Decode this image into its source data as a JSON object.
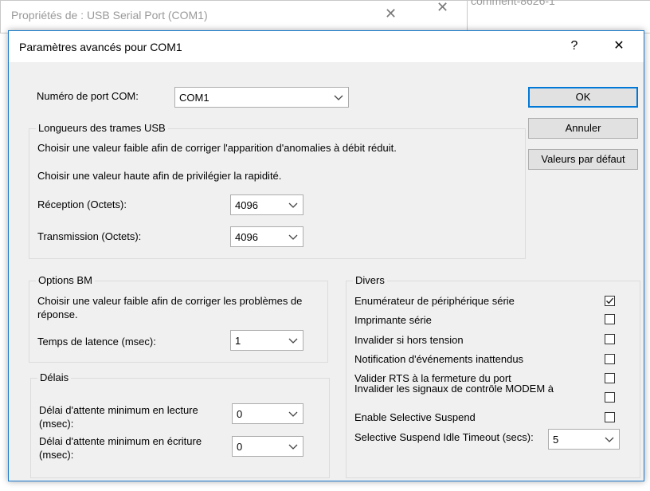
{
  "background": {
    "window_title": "Propriétés de : USB Serial Port (COM1)",
    "other_window_title": "comment-8626-1"
  },
  "dialog": {
    "title": "Paramètres avancés pour COM1",
    "help_label": "?",
    "close_label": "✕"
  },
  "com_port": {
    "label": "Numéro de port COM:",
    "value": "COM1"
  },
  "usb_frames": {
    "title": "Longueurs des trames USB",
    "desc_low": "Choisir une valeur faible afin de corriger  l'apparition d'anomalies à débit réduit.",
    "desc_high": "Choisir une valeur haute afin de privilégier la rapidité.",
    "reception_label": "Réception (Octets):",
    "reception_value": "4096",
    "transmission_label": "Transmission (Octets):",
    "transmission_value": "4096"
  },
  "bm_options": {
    "title": "Options BM",
    "desc": "Choisir une valeur faible afin de corriger les problèmes de réponse.",
    "latency_label": "Temps de latence (msec):",
    "latency_value": "1"
  },
  "timeouts": {
    "title": "Délais",
    "read_label": "Délai d'attente minimum en lecture (msec):",
    "read_value": "0",
    "write_label": "Délai d'attente minimum en écriture (msec):",
    "write_value": "0"
  },
  "misc": {
    "title": "Divers",
    "items": [
      {
        "label": "Enumérateur de périphérique série",
        "checked": true
      },
      {
        "label": "Imprimante série",
        "checked": false
      },
      {
        "label": "Invalider si hors tension",
        "checked": false
      },
      {
        "label": "Notification d'événements inattendus",
        "checked": false
      },
      {
        "label": "Valider RTS à la fermeture du port",
        "checked": false
      },
      {
        "label": "Invalider les signaux de contrôle MODEM à l'initialisation",
        "checked": false
      },
      {
        "label": "Enable Selective Suspend",
        "checked": false
      }
    ],
    "suspend_label": "Selective Suspend Idle Timeout (secs):",
    "suspend_value": "5"
  },
  "buttons": {
    "ok": "OK",
    "cancel": "Annuler",
    "defaults": "Valeurs par défaut"
  },
  "colors": {
    "accent": "#0078d7",
    "dialog_bg": "#f0f0f0",
    "titlebar_border": "#1979ca"
  }
}
